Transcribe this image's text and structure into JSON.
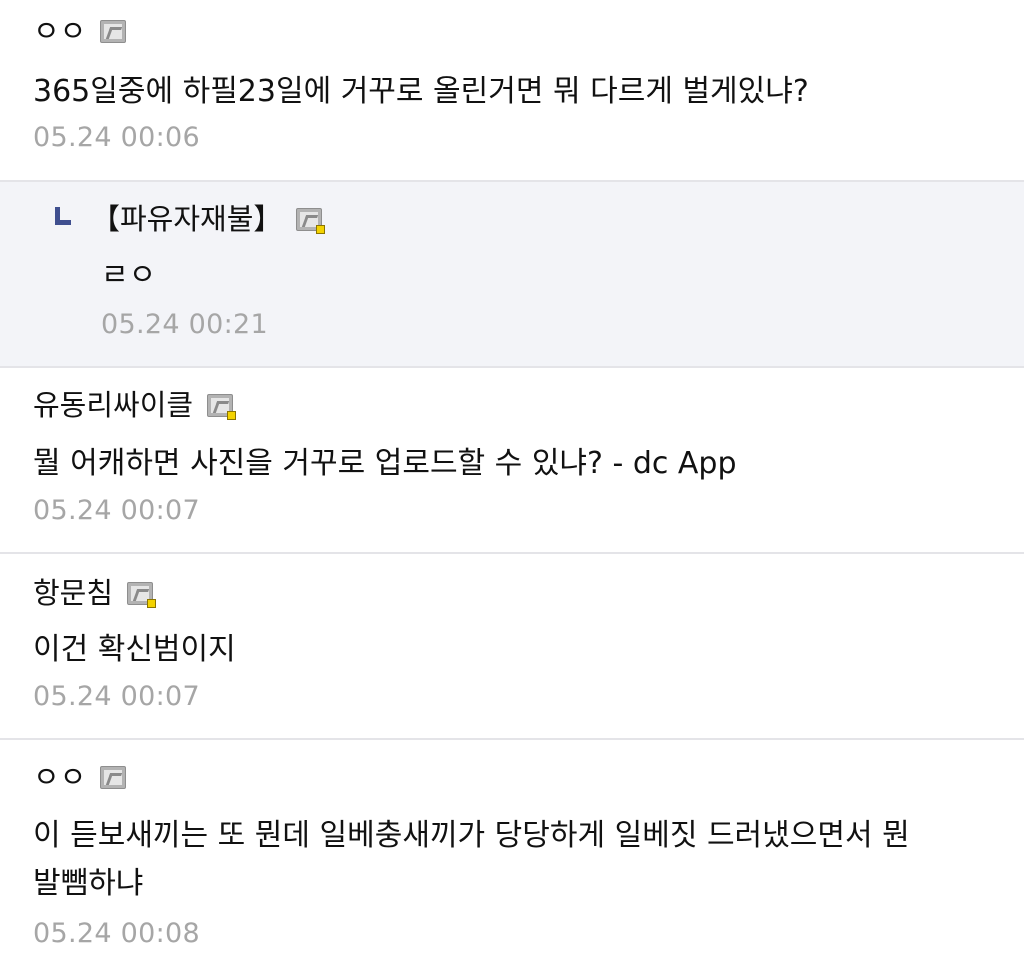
{
  "comments": [
    {
      "author": "ㅇㅇ",
      "badge_icon": "gallery-member-icon",
      "text": "365일중에 하필23일에 거꾸로 올린거면 뭐 다르게 벌게있냐?",
      "date": "05.24 00:06",
      "is_reply": false
    },
    {
      "author": "【파유자재불】",
      "badge_icon": "gallery-member-fixed-icon",
      "text": "ㄹㅇ",
      "date": "05.24 00:21",
      "is_reply": true
    },
    {
      "author": "유동리싸이클",
      "badge_icon": "gallery-member-fixed-icon",
      "text": "뭘 어캐하면 사진을 거꾸로 업로드할 수 있냐? - dc App",
      "date": "05.24 00:07",
      "is_reply": false
    },
    {
      "author": "항문침",
      "badge_icon": "gallery-member-fixed-icon",
      "text": "이건 확신범이지",
      "date": "05.24 00:07",
      "is_reply": false
    },
    {
      "author": "ㅇㅇ",
      "badge_icon": "gallery-member-icon",
      "text": "이 듣보새끼는 또 뭔데 일베충새끼가 당당하게 일베짓 드러냈으면서 뭔\n발뺌하냐",
      "date": "05.24 00:08",
      "is_reply": false
    }
  ]
}
